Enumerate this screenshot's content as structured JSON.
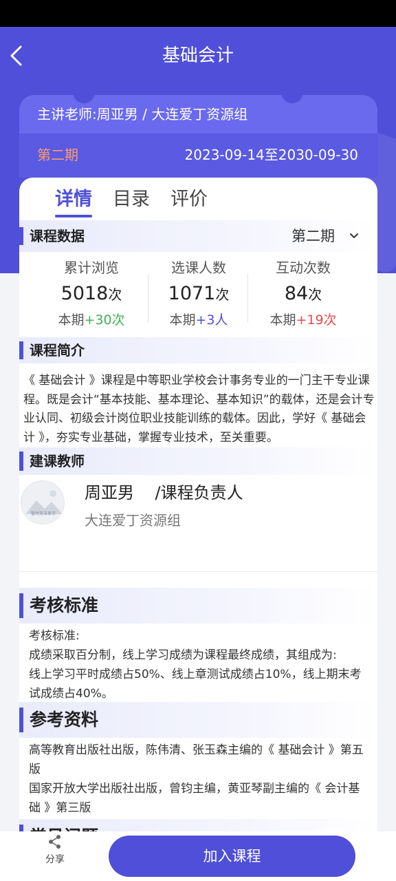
{
  "header": {
    "title": "基础会计",
    "teacher_line": "主讲老师:周亚男 / 大连爱丁资源组",
    "term": "第二期",
    "date_range": "2023-09-14至2030-09-30"
  },
  "tabs": [
    {
      "label": "详情",
      "active": true
    },
    {
      "label": "目录",
      "active": false
    },
    {
      "label": "评价",
      "active": false
    }
  ],
  "course_data": {
    "section_title": "课程数据",
    "term_select": "第二期",
    "stats": [
      {
        "title": "累计浏览",
        "value": "5018",
        "unit": "次",
        "delta_prefix": "本期",
        "delta": "+30次",
        "delta_color": "#3fb24f"
      },
      {
        "title": "选课人数",
        "value": "1071",
        "unit": "次",
        "delta_prefix": "本期",
        "delta": "+3人",
        "delta_color": "#4f4fd9"
      },
      {
        "title": "互动次数",
        "value": "84",
        "unit": "次",
        "delta_prefix": "本期",
        "delta": "+19次",
        "delta_color": "#e5484d"
      }
    ]
  },
  "intro": {
    "section_title": "课程简介",
    "text": "《 基础会计 》课程是中等职业学校会计事务专业的一门主干专业课程。既是会计“基本技能、基本理论、基本知识”的载体，还是会计专业认同、初级会计岗位职业技能训练的载体。因此，学好《 基础会计 》，夯实专业基础，掌握专业技术，至关重要。"
  },
  "teachers": {
    "section_title": "建课教师",
    "name_line": "周亚男    /课程负责人",
    "org": "大连爱丁资源组",
    "avatar_text": "暂时无法显示"
  },
  "assessment": {
    "section_title": "考核标准",
    "lines": [
      "考核标准:",
      "成绩采取百分制，线上学习成绩为课程最终成绩，其组成为:",
      "线上学习平时成绩占50%、线上章测试成绩占10%，线上期末考试成绩占40%。"
    ]
  },
  "references": {
    "section_title": "参考资料",
    "lines": [
      "高等教育出版社出版，陈伟清、张玉森主编的《 基础会计 》第五版",
      "国家开放大学出版社出版，曾钧主编，黄亚琴副主编的《 会计基础 》第三版"
    ]
  },
  "faq": {
    "section_title": "常见问题"
  },
  "bottom": {
    "share_label": "分享",
    "join_label": "加入课程"
  },
  "colors": {
    "accent": "#4f4fd9",
    "term_orange": "#ff9a6a"
  }
}
